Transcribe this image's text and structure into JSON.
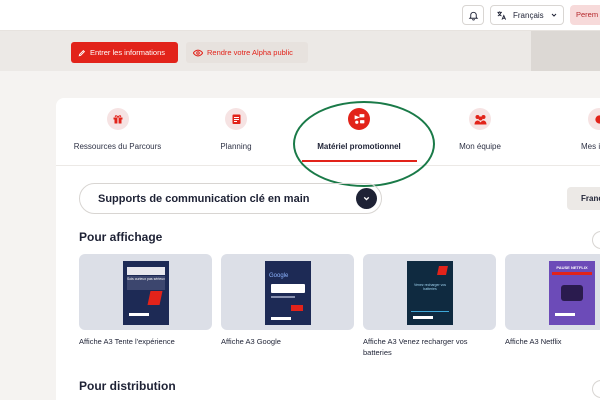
{
  "header": {
    "language": "Français",
    "user_button": "Perem"
  },
  "actions": {
    "primary_label": "Entrer les informations",
    "secondary_label": "Rendre votre Alpha public"
  },
  "tabs": [
    {
      "label": "Ressources du Parcours",
      "icon": "gift-icon"
    },
    {
      "label": "Planning",
      "icon": "calendar-icon"
    },
    {
      "label": "Matériel promotionnel",
      "icon": "promo-icon",
      "active": true
    },
    {
      "label": "Mon équipe",
      "icon": "team-icon"
    },
    {
      "label": "Mes i",
      "icon": "info-icon"
    }
  ],
  "dropdown": {
    "value": "Supports de communication clé en main"
  },
  "filter_button": "Franç",
  "sections": {
    "display_title": "Pour affichage",
    "distribution_title": "Pour distribution"
  },
  "posters": [
    {
      "label": "Affiche A3 Tente l'expérience",
      "poster_text": "Sois curieux pas sérieux"
    },
    {
      "label": "Affiche A3 Google",
      "poster_text": "Google"
    },
    {
      "label": "Affiche A3 Venez recharger vos batteries",
      "poster_text": "Venez recharger vos batteries"
    },
    {
      "label": "Affiche A3 Netflix",
      "poster_text": "PAUSE NETFLIX"
    }
  ],
  "colors": {
    "brand_red": "#e2231a",
    "navy": "#1d2a55",
    "highlight_green": "#1a7a48"
  }
}
